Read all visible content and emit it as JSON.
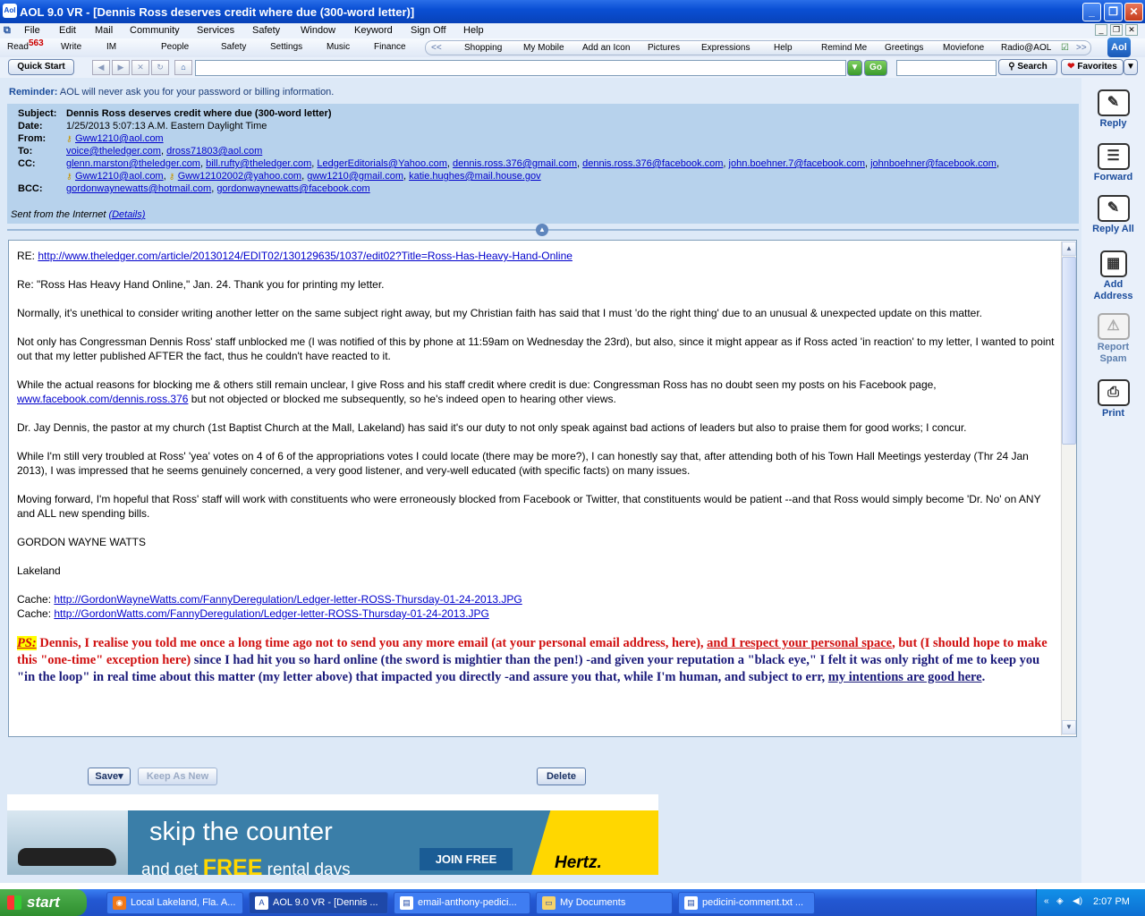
{
  "window": {
    "title": "AOL 9.0 VR - [Dennis Ross deserves credit where due (300-word letter)]",
    "app_icon": "Aol"
  },
  "menu": [
    "File",
    "Edit",
    "Mail",
    "Community",
    "Services",
    "Safety",
    "Window",
    "Keyword",
    "Sign Off",
    "Help"
  ],
  "toolbar": {
    "read_label": "Read",
    "read_count": "563",
    "items": [
      "Write",
      "IM",
      "People",
      "Safety",
      "Settings",
      "Music",
      "Finance"
    ],
    "right_items": [
      "Shopping",
      "My Mobile",
      "Add an Icon",
      "Pictures",
      "Expressions",
      "Help",
      "Remind Me",
      "Greetings",
      "Moviefone",
      "Radio@AOL"
    ]
  },
  "navbar": {
    "quick_start": "Quick Start",
    "go": "Go",
    "search": "Search",
    "favorites": "Favorites",
    "url_value": "",
    "search_value": ""
  },
  "reminder": {
    "label": "Reminder:",
    "text": "AOL will never ask you for your password or billing information."
  },
  "email": {
    "labels": {
      "subject": "Subject:",
      "date": "Date:",
      "from": "From:",
      "to": "To:",
      "cc": "CC:",
      "bcc": "BCC:"
    },
    "subject": "Dennis Ross deserves credit where due (300-word letter)",
    "date": "1/25/2013 5:07:13 A.M. Eastern Daylight Time",
    "from": "Gww1210@aol.com",
    "to": [
      "voice@theledger.com",
      "dross71803@aol.com"
    ],
    "cc_line1": [
      "glenn.marston@theledger.com",
      "bill.rufty@theledger.com",
      "LedgerEditorials@Yahoo.com",
      "dennis.ross.376@gmail.com",
      "dennis.ross.376@facebook.com",
      "john.boehner.7@facebook.com",
      "johnboehner@facebook.com"
    ],
    "cc_line2": [
      "Gww1210@aol.com",
      "Gww12102002@yahoo.com",
      "gww1210@gmail.com",
      "katie.hughes@mail.house.gov"
    ],
    "bcc": [
      "gordonwaynewatts@hotmail.com",
      "gordonwaynewatts@facebook.com"
    ],
    "sent_from": "Sent from the Internet",
    "details": "(Details)"
  },
  "body": {
    "re_prefix": "RE:",
    "re_link": "http://www.theledger.com/article/20130124/EDIT02/130129635/1037/edit02?Title=Ross-Has-Heavy-Hand-Online",
    "p1": "Re: \"Ross Has Heavy Hand Online,\" Jan. 24. Thank you for printing my letter.",
    "p2": "Normally, it's unethical to consider writing another letter on the same subject right away, but my Christian faith has said that I must 'do the right thing' due to an unusual & unexpected update on this matter.",
    "p3": "Not only has Congressman Dennis Ross' staff unblocked me (I was notified of this by phone at 11:59am on Wednesday the 23rd), but also, since it might appear as if Ross acted 'in reaction' to my letter, I wanted to point out that my letter published AFTER the fact, thus he couldn't have reacted to it.",
    "p4a": "While the actual reasons for blocking me & others still remain unclear, I give Ross and his staff credit where credit is due: Congressman Ross has no doubt seen my posts on his Facebook page,",
    "p4link": "www.facebook.com/dennis.ross.376",
    "p4b": "but not objected or blocked me subsequently, so he's indeed open to hearing other views.",
    "p5": "Dr. Jay Dennis, the pastor at my church (1st Baptist Church at the Mall, Lakeland) has said it's our duty to not only speak against bad actions of leaders but also to praise them for good works; I concur.",
    "p6": "While I'm still very troubled at Ross' 'yea' votes on 4 of 6 of the appropriations votes I could locate (there may be more?), I can honestly say that, after attending both of his Town Hall Meetings yesterday (Thr 24 Jan 2013), I was impressed that he seems genuinely concerned, a very good listener, and very-well educated (with specific facts) on many issues.",
    "p7": "Moving forward, I'm hopeful that Ross' staff will work with constituents who were erroneously blocked from Facebook or Twitter, that constituents would be patient --and that Ross would simply become 'Dr. No' on ANY and ALL new spending bills.",
    "sig_name": "GORDON WAYNE WATTS",
    "sig_city": "Lakeland",
    "cache_label": "Cache:",
    "cache1": "http://GordonWayneWatts.com/FannyDeregulation/Ledger-letter-ROSS-Thursday-01-24-2013.JPG",
    "cache2": "http://GordonWatts.com/FannyDeregulation/Ledger-letter-ROSS-Thursday-01-24-2013.JPG",
    "ps_label": "PS:",
    "ps_red1": " Dennis, I realise you told me once a long time ago not to send you any more email (at your personal email address, here), ",
    "ps_red_u": "and I respect your personal space",
    "ps_red2": ", but (I should hope to make this \"one-time\" exception here)",
    "ps_blue": " since I had hit you so hard online (the sword is mightier than the pen!) -and given your reputation a \"black eye,\" I felt it was only right of me to keep you \"in the loop\" in real time about this matter (my letter above) that impacted you directly -and assure you that, while I'm human, and subject to err, ",
    "ps_blue_u": "my intentions are good here",
    "ps_end": "."
  },
  "actions": {
    "save": "Save▾",
    "keep_as_new": "Keep As New",
    "delete": "Delete"
  },
  "ad": {
    "headline": "skip the counter",
    "sub_a": "and get",
    "sub_free": "FREE",
    "sub_b": "rental days",
    "join": "JOIN FREE",
    "brand": "Hertz."
  },
  "right_panel": [
    "Reply",
    "Forward",
    "Reply All",
    "Add Address",
    "Report Spam",
    "Print"
  ],
  "taskbar": {
    "start": "start",
    "tasks": [
      "Local Lakeland, Fla. A...",
      "AOL 9.0 VR - [Dennis ...",
      "email-anthony-pedici...",
      "My Documents",
      "pedicini-comment.txt ..."
    ],
    "clock": "2:07 PM"
  }
}
